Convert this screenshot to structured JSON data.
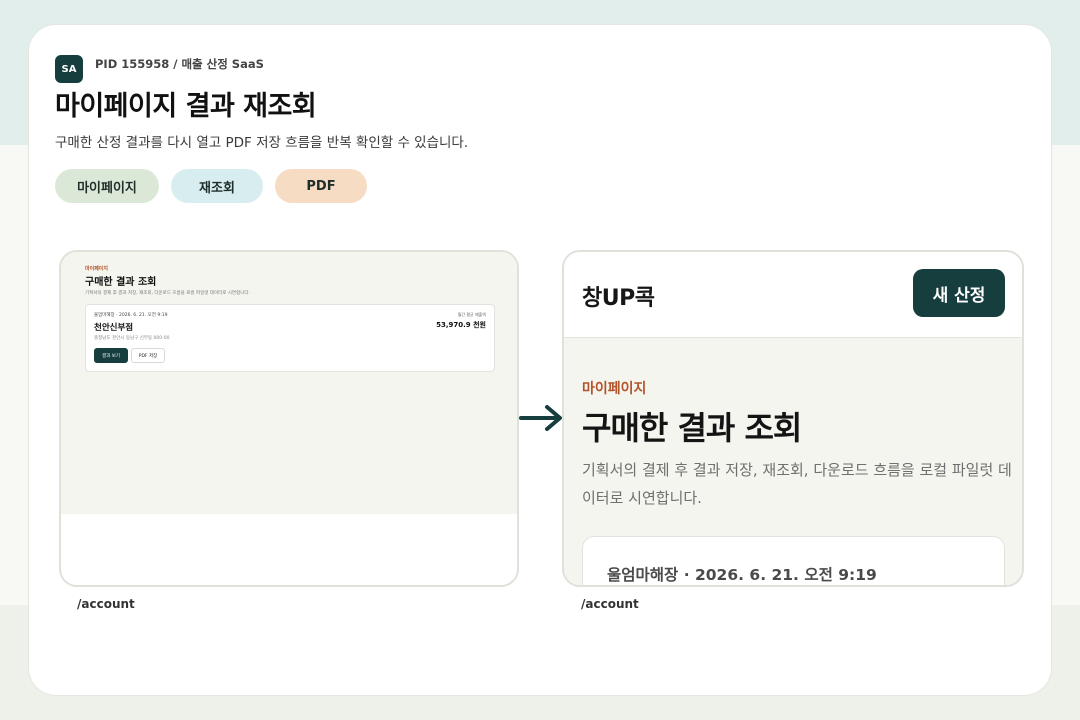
{
  "header": {
    "badge": "SA",
    "pid": "PID 155958 / 매출 산정 SaaS",
    "title": "마이페이지 결과 재조회",
    "subtitle": "구매한 산정 결과를 다시 열고 PDF 저장 흐름을 반복 확인할 수 있습니다."
  },
  "chips": [
    "마이페이지",
    "재조회",
    "PDF"
  ],
  "left_shot": {
    "caption": "/account",
    "eyebrow": "마이페이지",
    "title": "구매한 결과 조회",
    "desc": "기획서의 결제 후 결과 저장, 재조회, 다운로드 흐름을 로컬 파일럿 데이터로 시연합니다.",
    "card": {
      "meta": "울엄마해장 · 2026. 6. 21. 오전 9:19",
      "store": "천안신부점",
      "address": "충청남도 천안시 동남구 신부동 000-00",
      "sales_label": "월간 평균 매출액",
      "sales": "53,970.9 천원",
      "view_button": "결과 보기",
      "pdf_button": "PDF 저장"
    }
  },
  "right_shot": {
    "caption": "/account",
    "logo": "창UP콕",
    "new_button": "새 산정",
    "eyebrow": "마이페이지",
    "title": "구매한 결과 조회",
    "desc": "기획서의 결제 후 결과 저장, 재조회, 다운로드 흐름을 로컬 파일럿 데이터로 시연합니다.",
    "card_meta": "울엄마해장 · 2026. 6. 21. 오전 9:19"
  },
  "colors": {
    "accent_dark": "#173e3f",
    "eyebrow": "#b4532a",
    "chip_green": "#dce8d7",
    "chip_blue": "#d8edf0",
    "chip_peach": "#f6dcc3"
  },
  "icons": [
    "arrow-right-icon"
  ]
}
